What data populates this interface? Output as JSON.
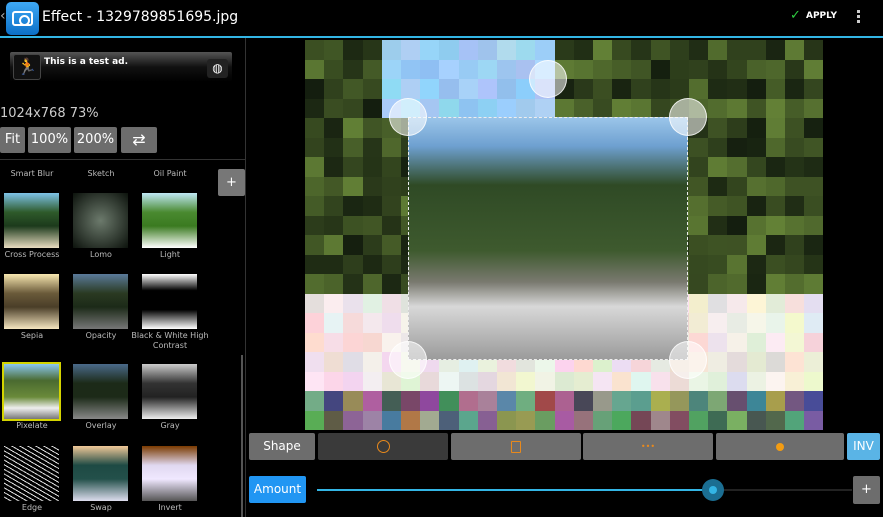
{
  "header": {
    "title": "Effect - 1329789851695.jpg",
    "apply_label": "APPLY",
    "icons": [
      "back-icon",
      "app-camera-icon",
      "check-icon",
      "overflow-menu-icon"
    ]
  },
  "ad": {
    "text": "This is a test ad."
  },
  "image_info": "1024x768 73%",
  "zoom_buttons": {
    "fit": "Fit",
    "z100": "100%",
    "z200": "200%"
  },
  "effects_header": [
    "Smart Blur",
    "Sketch",
    "Oil Paint"
  ],
  "add_effect_label": "+",
  "effects": [
    {
      "label": "Cross Process",
      "bg": "linear-gradient(#7ec3e8 0%,#2e5a2a 35%,#1c3a1c 60%,#e8dcc0 100%)"
    },
    {
      "label": "Lomo",
      "bg": "radial-gradient(#6c7a6c,#0c120c)"
    },
    {
      "label": "Light",
      "bg": "linear-gradient(#bfe8f5 0%,#4a8a30 35%,#3a7a20 60%,#fff 100%)"
    },
    {
      "label": "Sepia",
      "bg": "linear-gradient(#f7e7b0 0%,#6a5a3a 35%,#4a3e28 60%,#f5e6c0 100%)"
    },
    {
      "label": "Opacity",
      "bg": "linear-gradient(#5a7a9a 0%,#2a3a22 35%,#1c2a18 60%,#777 100%)"
    },
    {
      "label": "Black & White High Contrast",
      "bg": "linear-gradient(#fff 0%,#000 30%,#000 65%,#fff 100%)"
    },
    {
      "label": "Pixelate",
      "bg": "linear-gradient(#8cc8f0 0%,#4a6a30 30%,#6a8a3a 60%,#eee 80%,#777 100%)",
      "selected": true
    },
    {
      "label": "Overlay",
      "bg": "linear-gradient(#4a6a8a 0%,#1c2a18 35%,#1c2a18 60%,#888 100%)"
    },
    {
      "label": "Gray",
      "bg": "linear-gradient(#ccc 0%,#333 35%,#222 60%,#eee 100%)"
    },
    {
      "label": "Edge",
      "bg": "repeating-linear-gradient(30deg,#000 0 3px,#ddd 3px 4px)"
    },
    {
      "label": "Swap",
      "bg": "linear-gradient(#f0c898 0%,#1e4a44 35%,#23504a 60%,#dde 100%)"
    },
    {
      "label": "Invert",
      "bg": "linear-gradient(#7a3a00 0%,#e0d8f0 35%,#f0e8ff 60%,#555 100%)"
    }
  ],
  "shape_toolbar": {
    "label": "Shape",
    "options": [
      "circle",
      "rectangle",
      "line",
      "dot"
    ],
    "selected": "circle",
    "inv_label": "INV"
  },
  "amount": {
    "label": "Amount",
    "value_percent": 74,
    "plus_label": "+"
  },
  "colors": {
    "accent": "#33b5e5",
    "button": "#6d6d6d",
    "selected_shape_icon": "#e8891c",
    "amount_button": "#2196f3",
    "inv_button": "#5ab4e6"
  }
}
